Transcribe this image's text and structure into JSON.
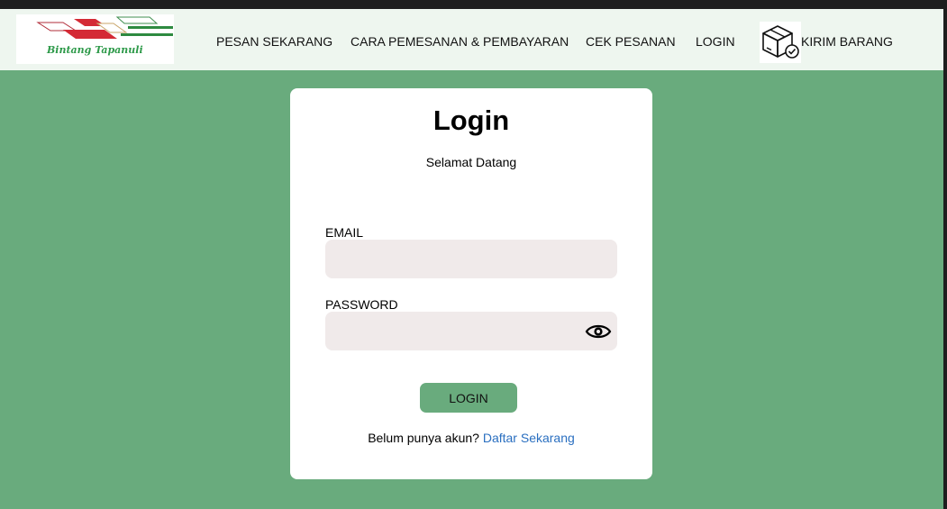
{
  "colors": {
    "background": "#69ab7d",
    "navbar": "#eef6ef",
    "card": "#ffffff",
    "input": "#f0eaea",
    "button": "#69ab7d",
    "link": "#2a6fc0"
  },
  "header": {
    "logo_text": "Bintang Tapanuli",
    "nav": [
      {
        "label": "PESAN SEKARANG"
      },
      {
        "label": "CARA PEMESANAN & PEMBAYARAN"
      },
      {
        "label": "CEK PESANAN"
      },
      {
        "label": "LOGIN"
      },
      {
        "label": "KIRIM BARANG",
        "icon": "package-check-icon"
      }
    ]
  },
  "login": {
    "title": "Login",
    "subtitle": "Selamat Datang",
    "email_label": "EMAIL",
    "email_value": "",
    "password_label": "PASSWORD",
    "password_value": "",
    "password_toggle_icon": "eye-icon",
    "button_label": "LOGIN",
    "register_prompt": "Belum punya akun?",
    "register_link": "Daftar Sekarang"
  }
}
